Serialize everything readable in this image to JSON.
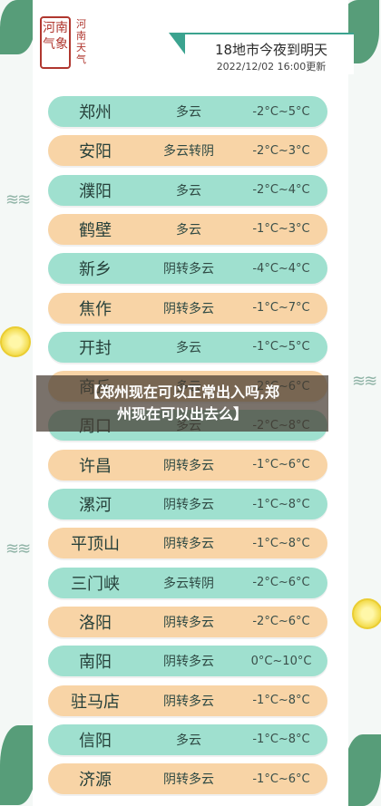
{
  "logo": {
    "seal_text": "河南气象",
    "side_text": "河南天气"
  },
  "banner": {
    "title": "18地市今夜到明天",
    "time": "2022/12/02 16:00更新"
  },
  "rows": [
    {
      "city": "郑州",
      "cond": "多云",
      "temp": "-2°C~5°C",
      "color": "teal"
    },
    {
      "city": "安阳",
      "cond": "多云转阴",
      "temp": "-2°C~3°C",
      "color": "peach"
    },
    {
      "city": "濮阳",
      "cond": "多云",
      "temp": "-2°C~4°C",
      "color": "teal"
    },
    {
      "city": "鹤壁",
      "cond": "多云",
      "temp": "-1°C~3°C",
      "color": "peach"
    },
    {
      "city": "新乡",
      "cond": "阴转多云",
      "temp": "-4°C~4°C",
      "color": "teal"
    },
    {
      "city": "焦作",
      "cond": "阴转多云",
      "temp": "-1°C~7°C",
      "color": "peach"
    },
    {
      "city": "开封",
      "cond": "多云",
      "temp": "-1°C~5°C",
      "color": "teal"
    },
    {
      "city": "商丘",
      "cond": "多云",
      "temp": "-2°C~6°C",
      "color": "peach"
    },
    {
      "city": "周口",
      "cond": "多云",
      "temp": "-2°C~8°C",
      "color": "teal"
    },
    {
      "city": "许昌",
      "cond": "阴转多云",
      "temp": "-1°C~6°C",
      "color": "peach"
    },
    {
      "city": "漯河",
      "cond": "阴转多云",
      "temp": "-1°C~8°C",
      "color": "teal"
    },
    {
      "city": "平顶山",
      "cond": "阴转多云",
      "temp": "-1°C~8°C",
      "color": "peach"
    },
    {
      "city": "三门峡",
      "cond": "多云转阴",
      "temp": "-2°C~6°C",
      "color": "teal"
    },
    {
      "city": "洛阳",
      "cond": "阴转多云",
      "temp": "-2°C~6°C",
      "color": "peach"
    },
    {
      "city": "南阳",
      "cond": "阴转多云",
      "temp": "0°C~10°C",
      "color": "teal"
    },
    {
      "city": "驻马店",
      "cond": "阴转多云",
      "temp": "-1°C~8°C",
      "color": "peach"
    },
    {
      "city": "信阳",
      "cond": "多云",
      "temp": "-1°C~8°C",
      "color": "teal"
    },
    {
      "city": "济源",
      "cond": "阴转多云",
      "temp": "-1°C~6°C",
      "color": "peach"
    }
  ],
  "overlay": {
    "line1": "【郑州现在可以正常出入吗,郑",
    "line2": "州现在可以出去么】"
  }
}
